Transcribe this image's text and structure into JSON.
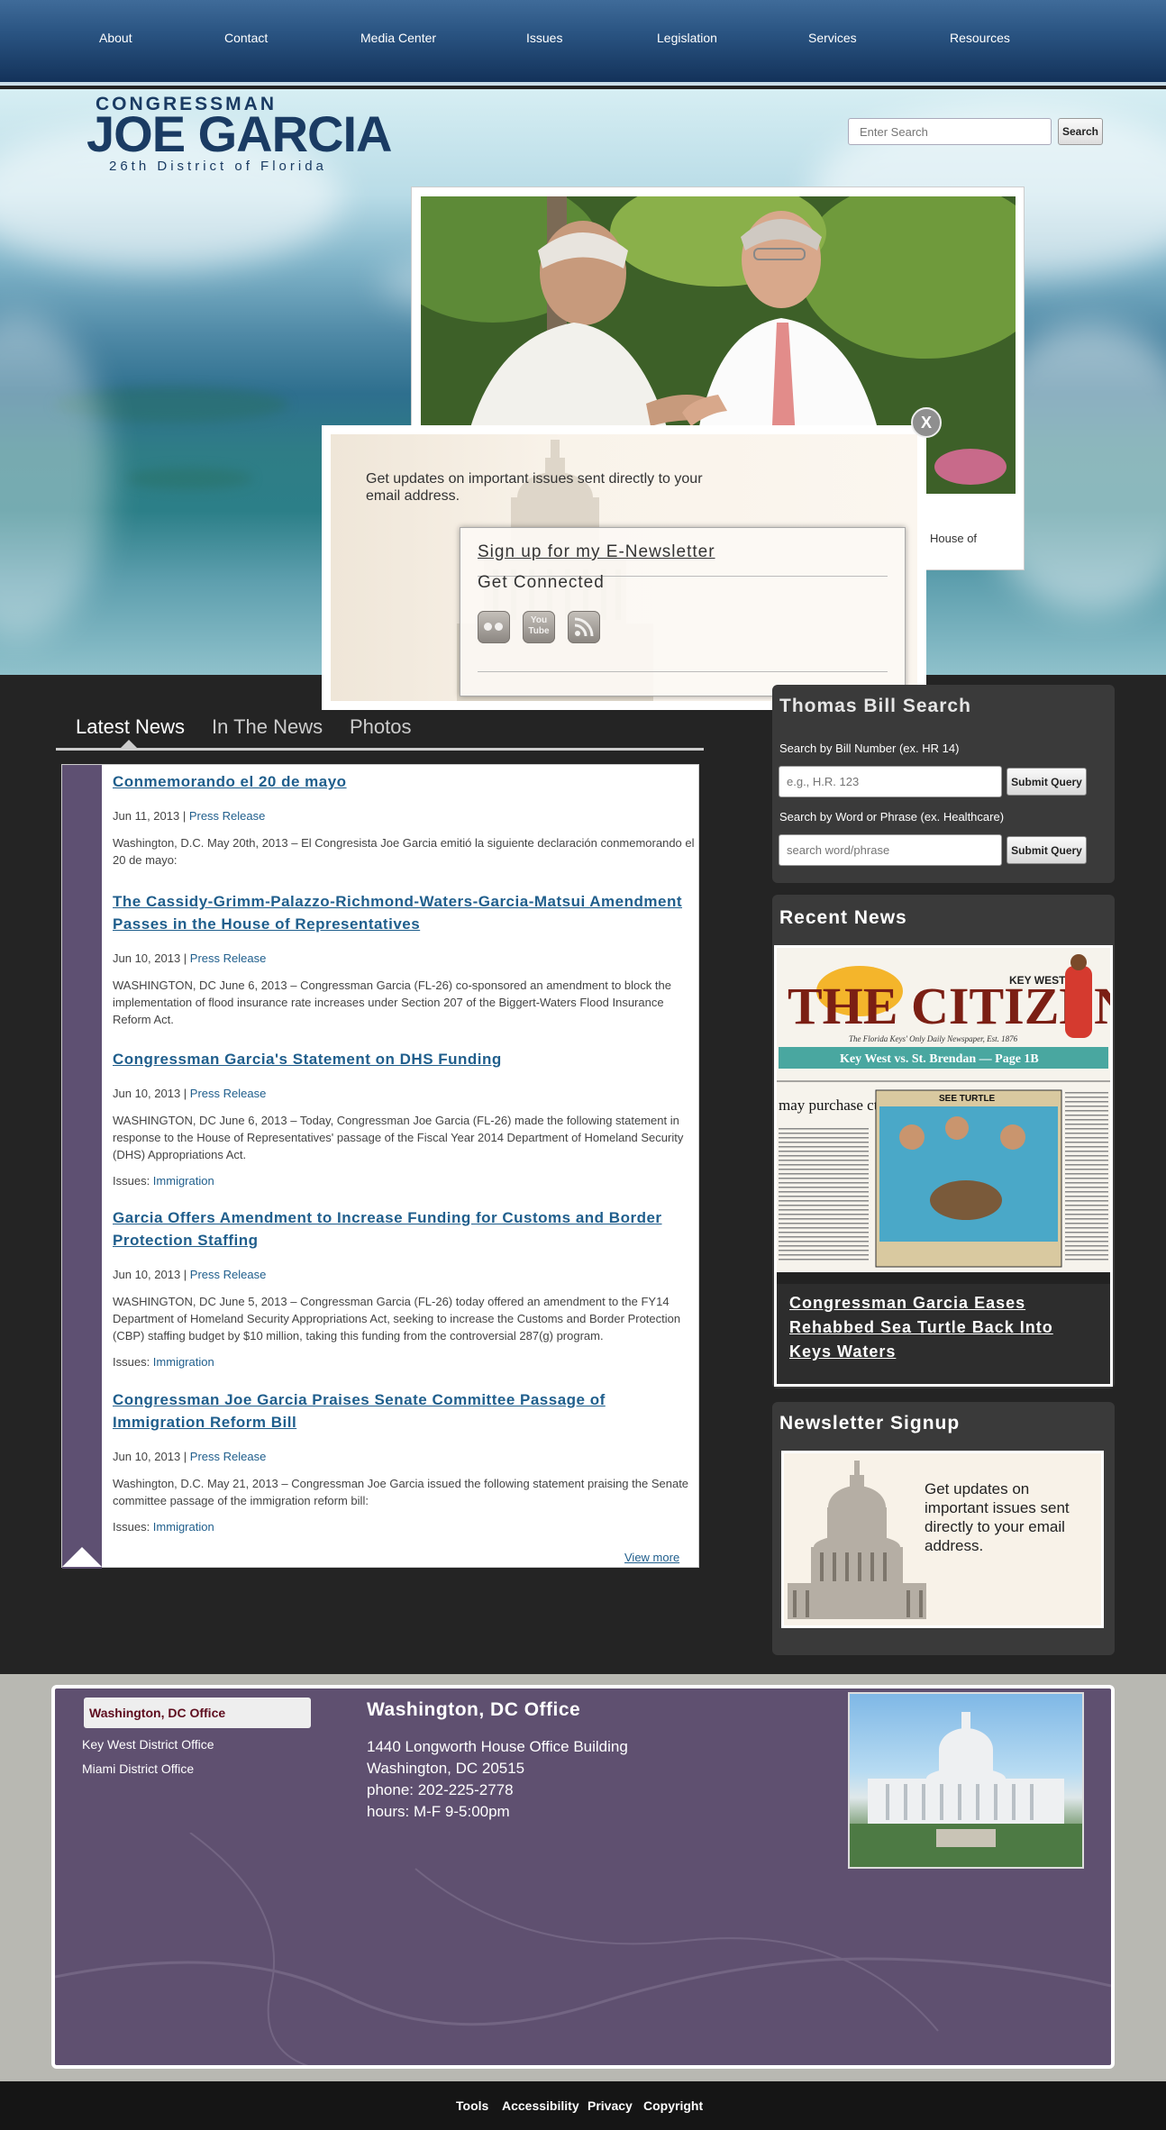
{
  "nav": {
    "items": [
      "About",
      "Contact",
      "Media Center",
      "Issues",
      "Legislation",
      "Services",
      "Resources"
    ]
  },
  "header": {
    "logo_line1": "CONGRESSMAN",
    "logo_line2": "JOE GARCIA",
    "logo_line3": "26th District of Florida",
    "search_placeholder": "Enter Search",
    "search_button": "Search"
  },
  "feature": {
    "caption_fragment": "House of"
  },
  "modal": {
    "text": "Get updates on important issues sent directly to your email address.",
    "signup_link": "Sign up for my E-Newsletter",
    "connected": "Get Connected",
    "close": "X",
    "social_icons": [
      "flickr-icon",
      "youtube-icon",
      "rss-icon"
    ],
    "youtube_label_1": "You",
    "youtube_label_2": "Tube"
  },
  "news_tabs": [
    "Latest News",
    "In The News",
    "Photos"
  ],
  "news": [
    {
      "title": "Conmemorando el 20 de mayo",
      "date": "Jun 11, 2013 | ",
      "category": "Press Release",
      "body": "Washington, D.C. May 20th, 2013 – El Congresista Joe Garcia emitió la siguiente declaración conmemorando el 20 de mayo:",
      "issues_label": "",
      "issue": ""
    },
    {
      "title": "The Cassidy-Grimm-Palazzo-Richmond-Waters-Garcia-Matsui Amendment Passes in the House of Representatives",
      "date": "Jun 10, 2013 | ",
      "category": "Press Release",
      "body": "WASHINGTON, DC June 6, 2013 – Congressman Garcia (FL-26) co-sponsored an amendment to block the implementation of flood insurance rate increases under Section 207 of the Biggert-Waters Flood Insurance Reform Act.",
      "issues_label": "",
      "issue": ""
    },
    {
      "title": "Congressman Garcia's Statement on DHS Funding",
      "date": "Jun 10, 2013 | ",
      "category": "Press Release",
      "body": "WASHINGTON, DC June 6, 2013 – Today, Congressman Joe Garcia (FL-26) made the following statement in response to the House of Representatives' passage of the Fiscal Year 2014 Department of Homeland Security (DHS) Appropriations Act.",
      "issues_label": "Issues: ",
      "issue": "Immigration"
    },
    {
      "title": "Garcia Offers Amendment to Increase Funding for Customs and Border Protection Staffing",
      "date": "Jun 10, 2013 | ",
      "category": "Press Release",
      "body": "WASHINGTON, DC June 5, 2013 – Congressman Garcia (FL-26) today offered an amendment to the FY14 Department of Homeland Security Appropriations Act, seeking to increase the Customs and Border Protection (CBP) staffing budget by $10 million, taking this funding from the controversial 287(g) program.",
      "issues_label": "Issues: ",
      "issue": "Immigration"
    },
    {
      "title": "Congressman Joe Garcia Praises Senate Committee Passage of Immigration Reform Bill",
      "date": "Jun 10, 2013 | ",
      "category": "Press Release",
      "body": "Washington, D.C. May 21, 2013 – Congressman Joe Garcia issued the following statement praising the Senate committee passage of the immigration reform bill:",
      "issues_label": "Issues: ",
      "issue": "Immigration"
    }
  ],
  "view_more": "View more",
  "bill_search": {
    "title": "Thomas Bill Search",
    "label_number": "Search by Bill Number (ex. HR 14)",
    "placeholder_number": "e.g., H.R. 123",
    "label_word": "Search by Word or Phrase (ex. Healthcare)",
    "placeholder_word": "search word/phrase",
    "submit": "Submit Query"
  },
  "recent_news": {
    "title": "Recent News",
    "paper_keywest": "KEY WEST",
    "paper_name": "THE CITIZEN",
    "paper_tagline": "The Florida Keys' Only Daily Newspaper, Est. 1876",
    "paper_banner": "Key West vs. St. Brendan — Page 1B",
    "paper_headline_left": "may purchase ctric vehicles",
    "paper_photo_title": "SEE TURTLE",
    "story_link": "Congressman Garcia Eases Rehabbed Sea Turtle Back Into Keys Waters"
  },
  "newsletter": {
    "title": "Newsletter Signup",
    "text": "Get updates on important issues sent directly to your email address."
  },
  "offices": {
    "tabs": [
      "Washington, DC Office",
      "Key West District Office",
      "Miami District Office"
    ],
    "active": {
      "title": "Washington, DC Office",
      "lines": [
        "1440 Longworth House Office Building",
        "Washington, DC 20515",
        "phone: 202-225-2778",
        "hours: M-F 9-5:00pm"
      ]
    }
  },
  "footer_links": [
    "Tools",
    "Accessibility",
    "Privacy",
    "Copyright"
  ]
}
